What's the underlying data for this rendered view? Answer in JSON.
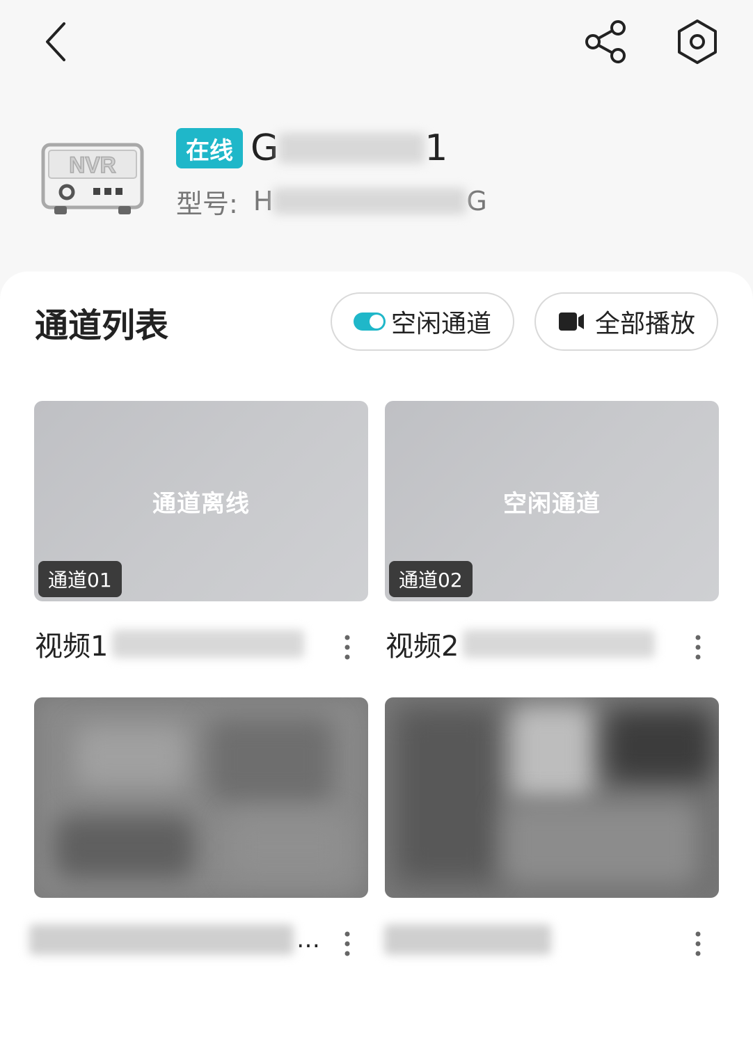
{
  "header": {
    "status": "在线",
    "device_name_prefix": "G",
    "device_name_suffix": "1",
    "model_label": "型号:",
    "model_prefix": "H",
    "model_suffix": "G",
    "device_logo_text": "NVR"
  },
  "channels": {
    "title": "通道列表",
    "idle_toggle_label": "空闲通道",
    "play_all_label": "全部播放",
    "tiles": [
      {
        "overlay": "通道离线",
        "tag": "通道01",
        "caption": "视频1"
      },
      {
        "overlay": "空闲通道",
        "tag": "通道02",
        "caption": "视频2"
      },
      {
        "overlay": "",
        "tag": "",
        "caption": "",
        "ellipsis": "…"
      },
      {
        "overlay": "",
        "tag": "",
        "caption": ""
      }
    ]
  },
  "colors": {
    "accent": "#1fb7c9",
    "background": "#f7f7f7"
  }
}
